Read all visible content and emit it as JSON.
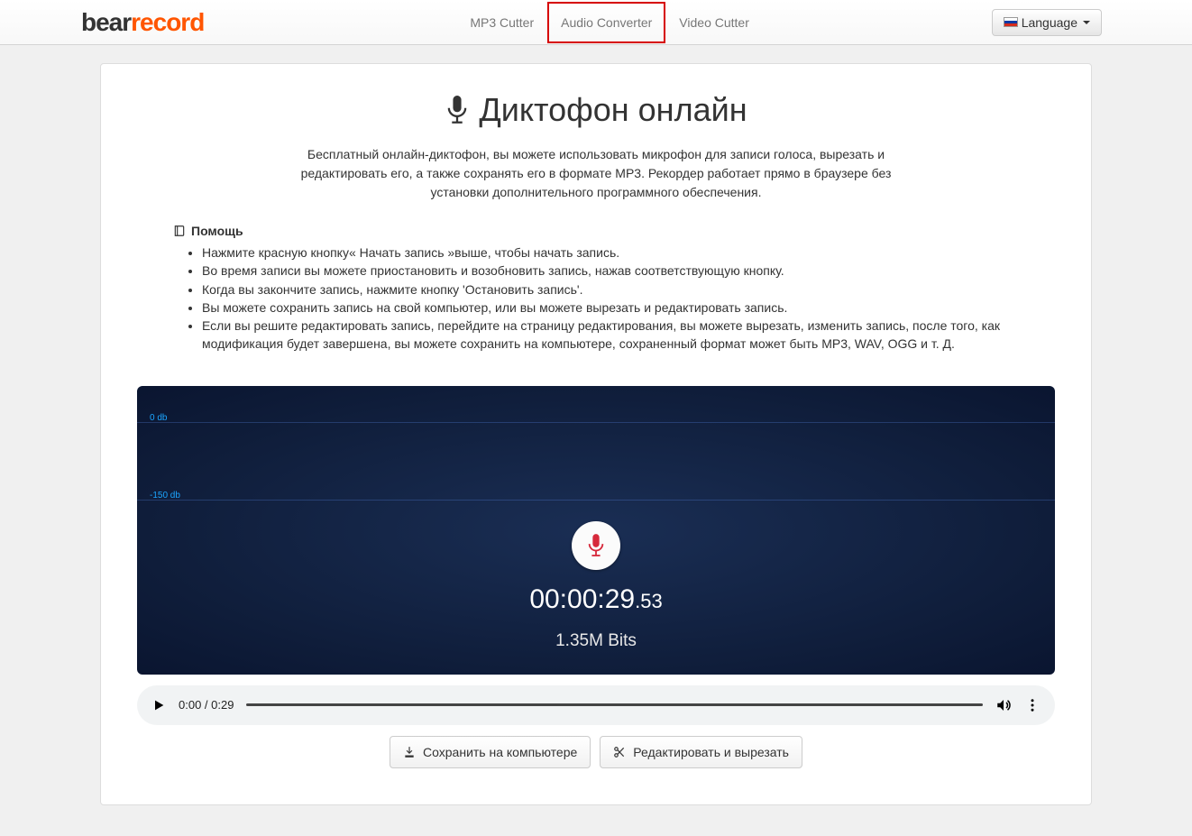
{
  "navbar": {
    "brand_bear": "bear",
    "brand_record": "record",
    "links": [
      {
        "label": "MP3 Cutter"
      },
      {
        "label": "Audio Converter"
      },
      {
        "label": "Video Cutter"
      }
    ],
    "language_label": "Language"
  },
  "page": {
    "title": "Диктофон онлайн",
    "lead": "Бесплатный онлайн-диктофон, вы можете использовать микрофон для записи голоса, вырезать и редактировать его, а также сохранять его в формате MP3. Рекордер работает прямо в браузере без установки дополнительного программного обеспечения."
  },
  "help": {
    "title": "Помощь",
    "items": [
      "Нажмите красную кнопку« Начать запись »выше, чтобы начать запись.",
      "Во время записи вы можете приостановить и возобновить запись, нажав соответствующую кнопку.",
      "Когда вы закончите запись, нажмите кнопку 'Остановить запись'.",
      "Вы можете сохранить запись на свой компьютер, или вы можете вырезать и редактировать запись.",
      "Если вы решите редактировать запись, перейдите на страницу редактирования, вы можете вырезать, изменить запись, после того, как модификация будет завершена, вы можете сохранить на компьютере, сохраненный формат может быть MP3, WAV, OGG и т. Д."
    ]
  },
  "recorder": {
    "db_top": "0 db",
    "db_mid": "-150 db",
    "timer_main": "00:00:29",
    "timer_ms": ".53",
    "size": "1.35M Bits"
  },
  "player": {
    "time": "0:00 / 0:29"
  },
  "actions": {
    "save": "Сохранить на компьютере",
    "edit": "Редактировать и вырезать"
  }
}
